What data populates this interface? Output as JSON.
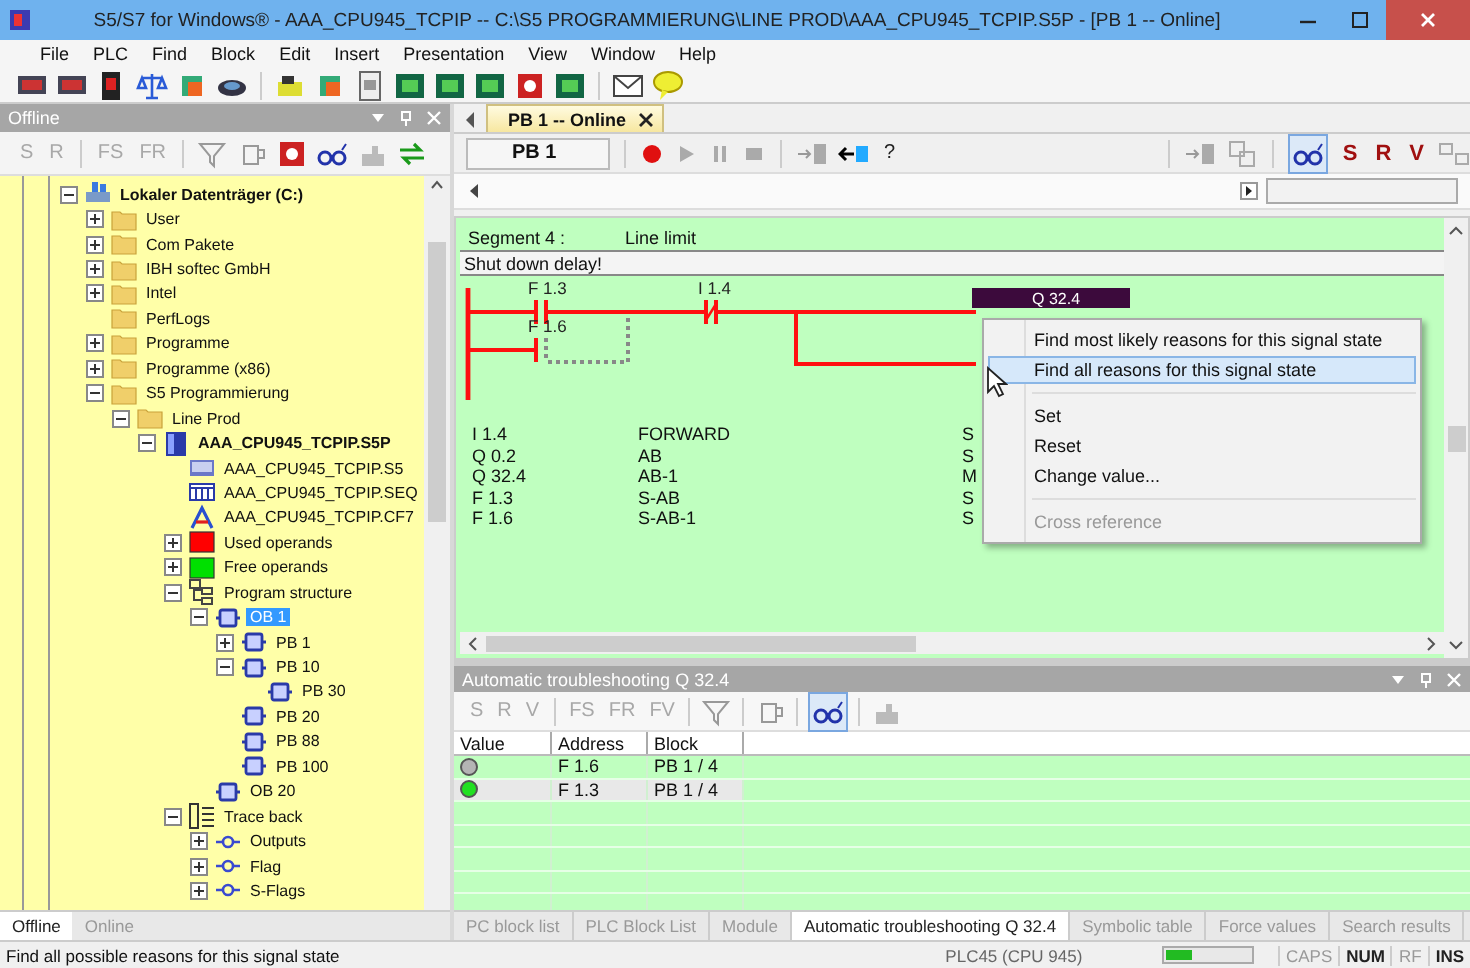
{
  "window": {
    "title": "S5/S7 for Windows® - AAA_CPU945_TCPIP -- C:\\S5 PROGRAMMIERUNG\\LINE PROD\\AAA_CPU945_TCPIP.S5P - [PB 1 -- Online]"
  },
  "menu": [
    "File",
    "PLC",
    "Find",
    "Block",
    "Edit",
    "Insert",
    "Presentation",
    "View",
    "Window",
    "Help"
  ],
  "offline_pane": {
    "title": "Offline",
    "toolbar": [
      {
        "label": "S",
        "disabled": true
      },
      {
        "label": "R",
        "disabled": true
      },
      {
        "label": "FS",
        "disabled": true
      },
      {
        "label": "FR",
        "disabled": true
      }
    ],
    "tree": [
      {
        "label": "Lokaler Datenträger (C:)",
        "kind": "drive",
        "expanded": true,
        "selected": false,
        "children": [
          {
            "label": "User",
            "kind": "folder",
            "expanded": false,
            "selected": false
          },
          {
            "label": "Com Pakete",
            "kind": "folder",
            "expanded": false,
            "selected": false
          },
          {
            "label": "IBH softec GmbH",
            "kind": "folder",
            "expanded": false,
            "selected": false
          },
          {
            "label": "Intel",
            "kind": "folder",
            "expanded": false,
            "selected": false
          },
          {
            "label": "PerfLogs",
            "kind": "folder",
            "selected": false
          },
          {
            "label": "Programme",
            "kind": "folder",
            "expanded": false,
            "selected": false
          },
          {
            "label": "Programme (x86)",
            "kind": "folder",
            "expanded": false,
            "selected": false
          },
          {
            "label": "S5 Programmierung",
            "kind": "folder",
            "expanded": true,
            "selected": false,
            "children": [
              {
                "label": "Line Prod",
                "kind": "folder",
                "expanded": true,
                "selected": false,
                "children": [
                  {
                    "label": "AAA_CPU945_TCPIP.S5P",
                    "kind": "project",
                    "expanded": true,
                    "selected": false,
                    "children": [
                      {
                        "label": "AAA_CPU945_TCPIP.S5",
                        "kind": "program-file",
                        "selected": false
                      },
                      {
                        "label": "AAA_CPU945_TCPIP.SEQ",
                        "kind": "sequence-file",
                        "selected": false
                      },
                      {
                        "label": "AAA_CPU945_TCPIP.CF7",
                        "kind": "config-file",
                        "selected": false
                      },
                      {
                        "label": "Used operands",
                        "kind": "operands",
                        "color": "#ff0000",
                        "expanded": false,
                        "selected": false
                      },
                      {
                        "label": "Free operands",
                        "kind": "operands",
                        "color": "#00e000",
                        "expanded": false,
                        "selected": false
                      },
                      {
                        "label": "Program structure",
                        "kind": "structure",
                        "expanded": true,
                        "selected": false,
                        "children": [
                          {
                            "label": "OB 1",
                            "kind": "block",
                            "expanded": true,
                            "selected": true,
                            "children": [
                              {
                                "label": "PB 1",
                                "kind": "block",
                                "expanded": false,
                                "selected": false
                              },
                              {
                                "label": "PB 10",
                                "kind": "block",
                                "expanded": true,
                                "selected": false,
                                "children": [
                                  {
                                    "label": "PB 30",
                                    "kind": "block",
                                    "selected": false
                                  }
                                ]
                              },
                              {
                                "label": "PB 20",
                                "kind": "block",
                                "selected": false
                              },
                              {
                                "label": "PB 88",
                                "kind": "block",
                                "selected": false
                              },
                              {
                                "label": "PB 100",
                                "kind": "block",
                                "selected": false
                              }
                            ]
                          },
                          {
                            "label": "OB 20",
                            "kind": "block",
                            "selected": false
                          }
                        ]
                      },
                      {
                        "label": "Trace back",
                        "kind": "trace",
                        "expanded": true,
                        "selected": false,
                        "children": [
                          {
                            "label": "Outputs",
                            "kind": "signal",
                            "expanded": false,
                            "selected": false
                          },
                          {
                            "label": "Flag",
                            "kind": "signal",
                            "expanded": false,
                            "selected": false
                          },
                          {
                            "label": "S-Flags",
                            "kind": "signal",
                            "expanded": false,
                            "selected": false
                          }
                        ]
                      }
                    ]
                  }
                ]
              }
            ]
          }
        ]
      }
    ],
    "tabs": [
      {
        "label": "Offline",
        "selected": true
      },
      {
        "label": "Online",
        "selected": false
      }
    ]
  },
  "editor": {
    "tab": "PB 1 -- Online",
    "block_field": "PB 1",
    "help_button": "?",
    "buttons": [
      {
        "label": "S",
        "disabled": false
      },
      {
        "label": "R",
        "disabled": false
      },
      {
        "label": "V",
        "disabled": false
      }
    ],
    "segment": {
      "number": "Segment 4 :",
      "title": "Line limit",
      "comment": "Shut down delay!"
    },
    "contacts": [
      {
        "label": "F 1.3",
        "kind": "normally-open",
        "state": true
      },
      {
        "label": "I 1.4",
        "kind": "normally-closed",
        "state": true
      },
      {
        "label": "F 1.6",
        "kind": "normally-open",
        "state": false
      }
    ],
    "coil": "Q 32.4",
    "symbols": [
      {
        "address": "I 1.4",
        "symbol": "FORWARD",
        "column_3": "S"
      },
      {
        "address": "Q 0.2",
        "symbol": "AB",
        "column_3": "S"
      },
      {
        "address": "Q 32.4",
        "symbol": "AB-1",
        "column_3": "M"
      },
      {
        "address": "F 1.3",
        "symbol": "S-AB",
        "column_3": "S"
      },
      {
        "address": "F 1.6",
        "symbol": "S-AB-1",
        "column_3": "S"
      }
    ]
  },
  "context_menu": [
    {
      "kind": "item",
      "label": "Find most likely reasons for this signal state",
      "selected": false,
      "disabled": false
    },
    {
      "kind": "item",
      "label": "Find all reasons for this signal state",
      "selected": true,
      "disabled": false
    },
    {
      "kind": "separator"
    },
    {
      "kind": "item",
      "label": "Set",
      "selected": false,
      "disabled": false
    },
    {
      "kind": "item",
      "label": "Reset",
      "selected": false,
      "disabled": false
    },
    {
      "kind": "item",
      "label": "Change value...",
      "selected": false,
      "disabled": false
    },
    {
      "kind": "separator"
    },
    {
      "kind": "item",
      "label": "Cross reference",
      "selected": false,
      "disabled": true
    }
  ],
  "troubleshooting": {
    "title": "Automatic troubleshooting Q 32.4",
    "toolbar": [
      {
        "label": "S",
        "disabled": true
      },
      {
        "label": "R",
        "disabled": true
      },
      {
        "label": "V",
        "disabled": true
      },
      {
        "label": "FS",
        "disabled": true
      },
      {
        "label": "FR",
        "disabled": true
      },
      {
        "label": "FV",
        "disabled": true
      }
    ],
    "columns": [
      "Value",
      "Address",
      "Block"
    ],
    "rows": [
      {
        "color": "#b4b4b4",
        "address": "F 1.6",
        "block": "PB 1 / 4",
        "selected": false
      },
      {
        "color": "#22e022",
        "address": "F 1.3",
        "block": "PB 1 / 4",
        "selected": true
      }
    ]
  },
  "bottom_tabs": [
    {
      "label": "PC block list",
      "selected": false
    },
    {
      "label": "PLC Block List",
      "selected": false
    },
    {
      "label": "Module",
      "selected": false
    },
    {
      "label": "Automatic troubleshooting Q 32.4",
      "selected": true
    },
    {
      "label": "Symbolic table",
      "selected": false
    },
    {
      "label": "Force values",
      "selected": false
    },
    {
      "label": "Search results",
      "selected": false
    }
  ],
  "status_bar": {
    "message": "Find all possible reasons for this signal state",
    "plc": "PLC45 (CPU 945)",
    "level": 0.3,
    "indicators": [
      {
        "label": "CAPS",
        "on": false
      },
      {
        "label": "NUM",
        "on": true
      },
      {
        "label": "RF",
        "on": false
      },
      {
        "label": "INS",
        "on": true
      }
    ]
  }
}
